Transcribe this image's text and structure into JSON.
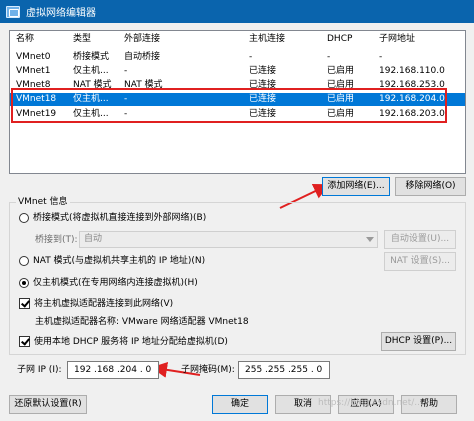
{
  "window": {
    "title": "虚拟网络编辑器"
  },
  "table": {
    "headers": [
      "名称",
      "类型",
      "外部连接",
      "主机连接",
      "DHCP",
      "子网地址"
    ],
    "rows": [
      {
        "name": "VMnet0",
        "type": "桥接模式",
        "external": "自动桥接",
        "host": "-",
        "dhcp": "-",
        "subnet": "-",
        "selected": false
      },
      {
        "name": "VMnet1",
        "type": "仅主机...",
        "external": "-",
        "host": "已连接",
        "dhcp": "已启用",
        "subnet": "192.168.110.0",
        "selected": false
      },
      {
        "name": "VMnet8",
        "type": "NAT 模式",
        "external": "NAT 模式",
        "host": "已连接",
        "dhcp": "已启用",
        "subnet": "192.168.253.0",
        "selected": false
      },
      {
        "name": "VMnet18",
        "type": "仅主机...",
        "external": "-",
        "host": "已连接",
        "dhcp": "已启用",
        "subnet": "192.168.204.0",
        "selected": true
      },
      {
        "name": "VMnet19",
        "type": "仅主机...",
        "external": "-",
        "host": "已连接",
        "dhcp": "已启用",
        "subnet": "192.168.203.0",
        "selected": false
      }
    ]
  },
  "buttons": {
    "add_network": "添加网络(E)...",
    "remove_network": "移除网络(O)",
    "auto_settings": "自动设置(U)...",
    "nat_settings": "NAT 设置(S)...",
    "dhcp_settings": "DHCP 设置(P)...",
    "restore_defaults": "还原默认设置(R)",
    "ok": "确定",
    "cancel": "取消",
    "apply": "应用(A)",
    "help": "帮助"
  },
  "vmnet_info": {
    "group_label": "VMnet 信息",
    "bridged_label": "桥接模式(将虚拟机直接连接到外部网络)(B)",
    "bridged_to_label": "桥接到(T):",
    "bridged_to_value": "自动",
    "nat_label": "NAT 模式(与虚拟机共享主机的 IP 地址)(N)",
    "hostonly_label": "仅主机模式(在专用网络内连接虚拟机)(H)",
    "connect_adapter_label": "将主机虚拟适配器连接到此网络(V)",
    "adapter_name_label": "主机虚拟适配器名称: VMware 网络适配器 VMnet18",
    "use_dhcp_label": "使用本地 DHCP 服务将 IP 地址分配给虚拟机(D)",
    "mode": "hostonly",
    "connect_adapter_checked": true,
    "use_dhcp_checked": true
  },
  "subnet": {
    "ip_label": "子网 IP (I):",
    "ip_value": "192 .168 .204 . 0",
    "mask_label": "子网掩码(M):",
    "mask_value": "255 .255 .255 . 0"
  },
  "watermark": "https://blog.csdn.net/...",
  "colors": {
    "title_bar": "#0a64ad",
    "selection": "#0078d7",
    "annotation": "#e02020"
  }
}
